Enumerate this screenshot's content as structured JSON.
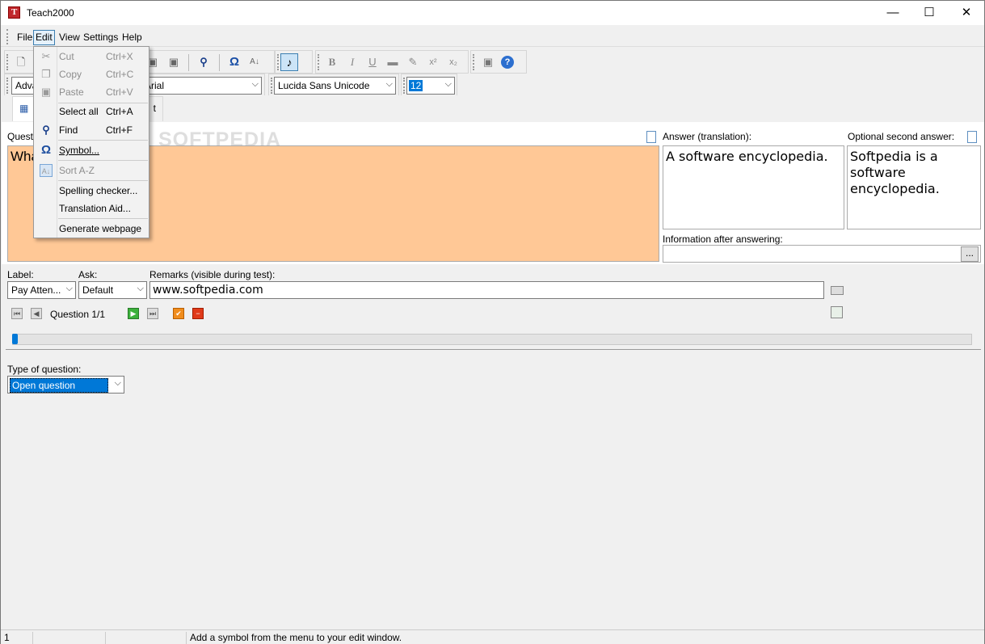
{
  "window": {
    "title": "Teach2000",
    "minimize": "—",
    "maximize": "☐",
    "close": "✕"
  },
  "menu": {
    "items": [
      "File",
      "Edit",
      "View",
      "Settings",
      "Help"
    ]
  },
  "toolbar": {
    "style_combo": "Adva",
    "font_combo": "Arial",
    "font2_combo": "Lucida Sans Unicode",
    "size_combo": "12"
  },
  "tabs": {
    "tab2": "t"
  },
  "edit_menu": {
    "cut": {
      "label": "Cut",
      "shortcut": "Ctrl+X"
    },
    "copy": {
      "label": "Copy",
      "shortcut": "Ctrl+C"
    },
    "paste": {
      "label": "Paste",
      "shortcut": "Ctrl+V"
    },
    "select_all": {
      "label": "Select all",
      "shortcut": "Ctrl+A"
    },
    "find": {
      "label": "Find",
      "shortcut": "Ctrl+F"
    },
    "symbol": {
      "label": "Symbol..."
    },
    "sort": {
      "label": "Sort A-Z"
    },
    "spelling": {
      "label": "Spelling checker..."
    },
    "translation_aid": {
      "label": "Translation Aid..."
    },
    "webpage": {
      "label": "Generate webpage"
    }
  },
  "editor": {
    "question_label": "Questio",
    "question_text": "Wha",
    "answer_label": "Answer (translation):",
    "answer_text": "A software encyclopedia.",
    "optional_label": "Optional second answer:",
    "optional_text": "Softpedia is a software encyclopedia.",
    "info_label": "Information after answering:",
    "info_button": "..."
  },
  "fields": {
    "label_label": "Label:",
    "label_value": "Pay Atten...",
    "ask_label": "Ask:",
    "ask_value": "Default",
    "remarks_label": "Remarks (visible during test):",
    "remarks_value": "www.softpedia.com"
  },
  "navigation": {
    "counter": "Question 1/1",
    "progress": 0
  },
  "question_type": {
    "label": "Type of question:",
    "value": "Open question"
  },
  "status": {
    "cell1": "1",
    "cell2": "",
    "cell3": "Add a symbol from the menu to your edit window."
  },
  "watermark": "SOFTPEDIA",
  "colors": {
    "question_bg": "#ffc896",
    "accent": "#0078d7"
  }
}
